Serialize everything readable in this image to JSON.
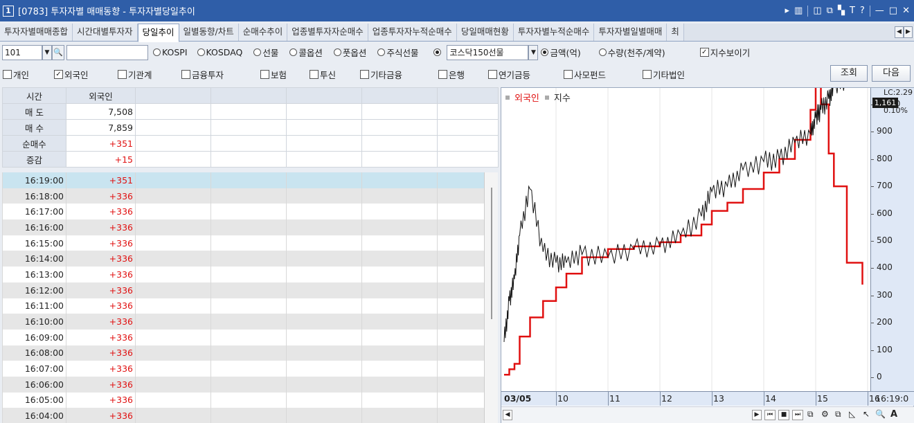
{
  "window": {
    "number": "1",
    "title": "[0783] 투자자별 매매동향 - 투자자별당일추이",
    "controls": [
      "▸",
      "▥",
      "◫",
      "⧉",
      "▚",
      "T",
      "?",
      "—",
      "□",
      "✕"
    ]
  },
  "tabs": [
    "투자자별매매종합",
    "시간대별투자자",
    "당일추이",
    "일별동향/차트",
    "순매수추이",
    "업종별투자자순매수",
    "업종투자자누적순매수",
    "당일매매현황",
    "투자자별누적순매수",
    "투자자별일별매매",
    "최"
  ],
  "active_tab": 2,
  "filter": {
    "code": "101",
    "code_name": "",
    "markets": [
      "KOSPI",
      "KOSDAQ",
      "선물",
      "콜옵션",
      "풋옵션",
      "주식선물"
    ],
    "selected_product": "코스닥150선물",
    "units": [
      "금액(억)",
      "수량(천주/계약)"
    ],
    "show_index_label": "지수보이기"
  },
  "investors": [
    "개인",
    "외국인",
    "기관계",
    "금융투자",
    "보험",
    "투신",
    "기타금융",
    "은행",
    "연기금등",
    "사모펀드",
    "기타법인"
  ],
  "buttons": {
    "query": "조회",
    "next": "다음"
  },
  "summary": {
    "headers": [
      "시간",
      "외국인"
    ],
    "rows": [
      {
        "label": "매 도",
        "value": "7,508"
      },
      {
        "label": "매 수",
        "value": "7,859"
      },
      {
        "label": "순매수",
        "value": "+351"
      },
      {
        "label": "증감",
        "value": "+15"
      }
    ]
  },
  "detail_rows": [
    {
      "time": "16:19:00",
      "value": "+351"
    },
    {
      "time": "16:18:00",
      "value": "+336"
    },
    {
      "time": "16:17:00",
      "value": "+336"
    },
    {
      "time": "16:16:00",
      "value": "+336"
    },
    {
      "time": "16:15:00",
      "value": "+336"
    },
    {
      "time": "16:14:00",
      "value": "+336"
    },
    {
      "time": "16:13:00",
      "value": "+336"
    },
    {
      "time": "16:12:00",
      "value": "+336"
    },
    {
      "time": "16:11:00",
      "value": "+336"
    },
    {
      "time": "16:10:00",
      "value": "+336"
    },
    {
      "time": "16:09:00",
      "value": "+336"
    },
    {
      "time": "16:08:00",
      "value": "+336"
    },
    {
      "time": "16:07:00",
      "value": "+336"
    },
    {
      "time": "16:06:00",
      "value": "+336"
    },
    {
      "time": "16:05:00",
      "value": "+336"
    },
    {
      "time": "16:04:00",
      "value": "+336"
    }
  ],
  "chart": {
    "legend": [
      "외국인",
      "지수"
    ],
    "y_top_label": "LC:2.29",
    "current_value": "1,161",
    "change": "0.10%",
    "y_ticks": [
      "1,000",
      "900",
      "800",
      "700",
      "600",
      "500",
      "400",
      "300",
      "200",
      "100",
      "0"
    ],
    "x_ticks": [
      "03/05",
      "10",
      "11",
      "12",
      "13",
      "14",
      "15",
      "16"
    ],
    "x_end": "16:19:0",
    "colors": {
      "foreign": "#e01010",
      "index": "#111111"
    }
  },
  "chart_data": {
    "type": "line",
    "x": [
      9.0,
      9.1,
      9.2,
      9.3,
      9.5,
      9.75,
      10.0,
      10.2,
      10.5,
      11.0,
      11.5,
      12.0,
      12.4,
      12.8,
      13.0,
      13.3,
      13.6,
      14.0,
      14.3,
      14.6,
      14.9,
      15.0,
      15.1,
      15.25,
      15.35,
      15.6,
      15.9
    ],
    "series": [
      {
        "name": "외국인",
        "values": [
          10,
          30,
          50,
          150,
          220,
          280,
          330,
          380,
          440,
          470,
          480,
          495,
          520,
          560,
          610,
          640,
          690,
          750,
          800,
          870,
          980,
          1080,
          1000,
          820,
          700,
          420,
          340
        ]
      },
      {
        "name": "지수",
        "values": [
          130,
          280,
          360,
          520,
          690,
          460,
          420,
          420,
          450,
          440,
          470,
          480,
          520,
          590,
          680,
          700,
          760,
          790,
          800,
          860,
          890,
          950,
          980,
          1020,
          1060,
          1090,
          1120
        ]
      }
    ],
    "ylim": [
      -50,
      1060
    ],
    "grid": true,
    "legend_position": "top-left"
  }
}
